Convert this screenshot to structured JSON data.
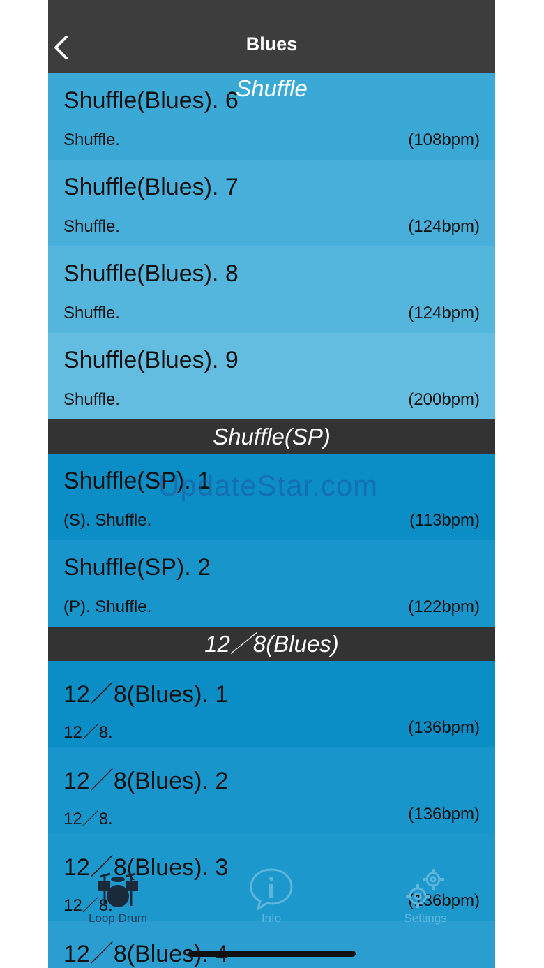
{
  "nav": {
    "title": "Blues"
  },
  "floating_header": "Shuffle",
  "watermark": "UpdateStar.com",
  "rows_top": [
    {
      "title": "Shuffle(Blues). 6",
      "subtitle": "Shuffle.",
      "bpm": "(108bpm)",
      "bg": "#3aa9d6"
    },
    {
      "title": "Shuffle(Blues). 7",
      "subtitle": "Shuffle.",
      "bpm": "(124bpm)",
      "bg": "#47afda"
    },
    {
      "title": "Shuffle(Blues). 8",
      "subtitle": "Shuffle.",
      "bpm": "(124bpm)",
      "bg": "#55b6dd"
    },
    {
      "title": "Shuffle(Blues). 9",
      "subtitle": "Shuffle.",
      "bpm": "(200bpm)",
      "bg": "#63bde0"
    }
  ],
  "sections": [
    {
      "header": "Shuffle(SP)",
      "rows": [
        {
          "title": "Shuffle(SP). 1",
          "subtitle": "(S). Shuffle.",
          "bpm": "(113bpm)",
          "bg": "#0b8dc5"
        },
        {
          "title": "Shuffle(SP). 2",
          "subtitle": "(P). Shuffle.",
          "bpm": "(122bpm)",
          "bg": "#1895ca"
        }
      ]
    },
    {
      "header": "12／8(Blues)",
      "rows": [
        {
          "title": "12／8(Blues). 1",
          "subtitle": "12／8.",
          "bpm": "(136bpm)",
          "bg": "#0b8dc5"
        },
        {
          "title": "12／8(Blues). 2",
          "subtitle": "12／8.",
          "bpm": "(136bpm)",
          "bg": "#1895ca"
        },
        {
          "title": "12／8(Blues). 3",
          "subtitle": "12／8.",
          "bpm": "(136bpm)",
          "bg": "#1d98cc"
        },
        {
          "title": "12／8(Blues). 4",
          "subtitle": "",
          "bpm": "",
          "bg": "#2a9ed0"
        }
      ]
    }
  ],
  "tabs": [
    {
      "label": "Loop Drum",
      "icon": "drum-icon",
      "active": true
    },
    {
      "label": "Info",
      "icon": "info-icon",
      "active": false
    },
    {
      "label": "Settings",
      "icon": "gear-icon",
      "active": false
    }
  ],
  "colors": {
    "navbar": "#3d3d3d",
    "section_header": "#333333",
    "tab_active": "#1a3a5a",
    "tab_inactive": "#5fb6dc"
  }
}
